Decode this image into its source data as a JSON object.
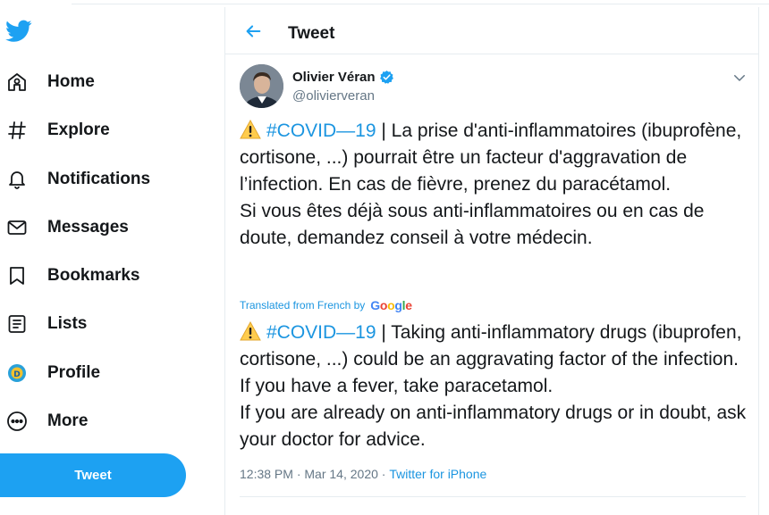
{
  "sidebar": {
    "items": [
      {
        "label": "Home",
        "icon": "home-icon"
      },
      {
        "label": "Explore",
        "icon": "hashtag-icon"
      },
      {
        "label": "Notifications",
        "icon": "bell-icon"
      },
      {
        "label": "Messages",
        "icon": "envelope-icon"
      },
      {
        "label": "Bookmarks",
        "icon": "bookmark-icon"
      },
      {
        "label": "Lists",
        "icon": "list-icon"
      },
      {
        "label": "Profile",
        "icon": "avatar-icon"
      },
      {
        "label": "More",
        "icon": "more-icon"
      }
    ],
    "tweet_button": "Tweet"
  },
  "header": {
    "title": "Tweet"
  },
  "tweet": {
    "author_name": "Olivier Véran",
    "handle": "@olivierveran",
    "original": {
      "hashtag": "#COVID—19",
      "line1_rest": " | La prise d'anti-inflammatoires (ibuprofène, cortisone, ...) pourrait être un facteur d'aggravation de l’infection. En cas de fièvre, prenez du paracétamol.",
      "line2": "Si vous êtes déjà sous anti-inflammatoires ou en cas de doute, demandez conseil à votre médecin."
    },
    "translation_label": "Translated from French by",
    "translation_provider": "Google",
    "translated": {
      "hashtag": "#COVID—19",
      "line1_rest": " | Taking anti-inflammatory drugs (ibuprofen, cortisone, ...) could be an aggravating factor of the infection. If you have a fever, take paracetamol.",
      "line2": " If you are already on anti-inflammatory drugs or in doubt, ask your doctor for advice."
    },
    "time": "12:38 PM",
    "separator": " · ",
    "date": "Mar 14, 2020",
    "source": "Twitter for iPhone"
  },
  "colors": {
    "accent": "#1da1f2",
    "link": "#1b95e0",
    "muted": "#657786"
  }
}
